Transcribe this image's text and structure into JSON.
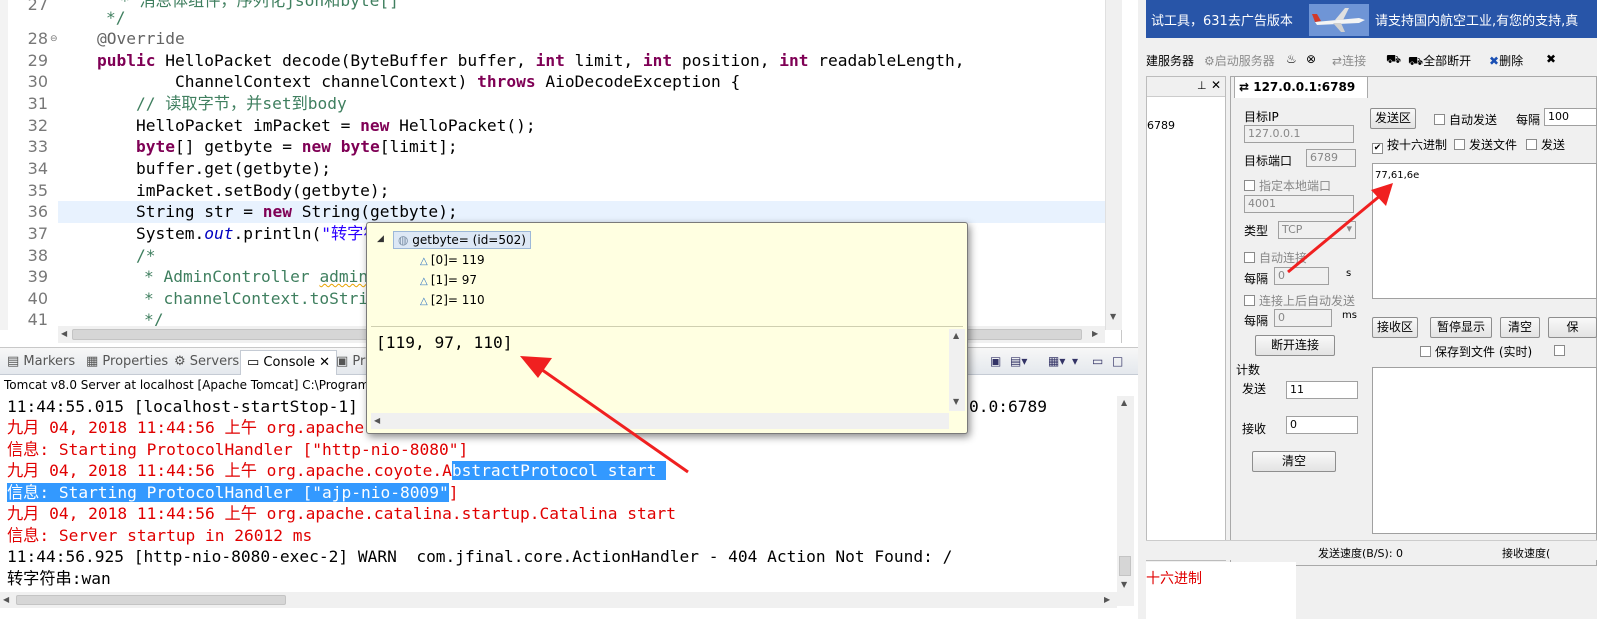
{
  "editor": {
    "line_numbers": [
      "27",
      "28",
      "29",
      "30",
      "31",
      "32",
      "33",
      "34",
      "35",
      "36",
      "37",
      "38",
      "39",
      "40",
      "41"
    ],
    "lines": {
      "l27_comment": "* 消息体组件，序列化json和byte[]",
      "l27b": "*/",
      "l28": "@Override",
      "l29_a": "public",
      "l29_b": " HelloPacket decode(ByteBuffer ",
      "l29_c": "buffer",
      "l29_d": ", ",
      "l29_e": "int",
      "l29_f": " ",
      "l29_g": "limit",
      "l29_h": ", ",
      "l29_i": "int",
      "l29_j": " ",
      "l29_k": "position",
      "l29_l": ", ",
      "l29_m": "int",
      "l29_n": " ",
      "l29_o": "readableLength",
      "l29_p": ",",
      "l30_a": "ChannelContext ",
      "l30_b": "channelContext",
      "l30_c": ") ",
      "l30_d": "throws",
      "l30_e": " AioDecodeException {",
      "l31": "// 读取字节，并set到body",
      "l32_a": "HelloPacket ",
      "l32_b": "imPacket",
      "l32_c": " = ",
      "l32_d": "new",
      "l32_e": " HelloPacket();",
      "l33_a": "byte",
      "l33_b": "[] ",
      "l33_c": "getbyte",
      "l33_d": " = ",
      "l33_e": "new",
      "l33_f": " ",
      "l33_g": "byte",
      "l33_h": "[",
      "l33_i": "limit",
      "l33_j": "];",
      "l34_a": "buffer",
      "l34_b": ".get(",
      "l34_c": "getbyte",
      "l34_d": ");",
      "l35_a": "imPacket",
      "l35_b": ".setBody(",
      "l35_c": "getbyte",
      "l35_d": ");",
      "l36_a": "String ",
      "l36_b": "str",
      "l36_c": " = ",
      "l36_d": "new",
      "l36_e": " String(",
      "l36_f": "getbyte",
      "l36_g": ");",
      "l37_a": "System.",
      "l37_b": "out",
      "l37_c": ".println(",
      "l37_d": "\"转字符",
      "l38": "/*",
      "l39_a": "* AdminController ",
      "l39_b": "admin",
      "l40": "* channelContext.toStri",
      "l41": "*/"
    }
  },
  "console": {
    "tabs": [
      "Markers",
      "Properties",
      "Servers",
      "Console",
      "Pr"
    ],
    "active_tab": "Console",
    "server_line": "Tomcat v8.0 Server at localhost [Apache Tomcat] C:\\Program Fi",
    "lines": {
      "c1a": "11:44:55.015 [localhost-startStop-1]",
      "c1b": "0.0:6789",
      "c2": "九月 04, 2018 11:44:56 上午 org.apache.c",
      "c3": "信息: Starting ProtocolHandler [\"http-nio-8080\"]",
      "c4a": "九月 04, 2018 11:44:56 上午 org.apache.coyote.A",
      "c4b": "bstractProtocol start ",
      "c5a": "信息: Starting ProtocolHandler [\"ajp-nio-8009\"",
      "c5b": "]",
      "c6": "九月 04, 2018 11:44:56 上午 org.apache.catalina.startup.Catalina start",
      "c7": "信息: Server startup in 26012 ms",
      "c8": "11:44:56.925 [http-nio-8080-exec-2] WARN  com.jfinal.core.ActionHandler - 404 Action Not Found: /",
      "c9": "转字符串:wan"
    }
  },
  "popup": {
    "root": "getbyte= (id=502)",
    "items": [
      "[0]= 119",
      "[1]= 97",
      "[2]= 110"
    ],
    "value": "[119, 97, 110]"
  },
  "tool": {
    "banner_left": "试工具，631去广告版本",
    "banner_right": "请支持国内航空工业,有您的支持,真",
    "toolbar": {
      "create_server": "建服务器",
      "start_server": "启动服务器",
      "connect": "连接",
      "disconnect_all": "全部断开",
      "delete": "删除"
    },
    "list_value": "6789",
    "conn_tab": "127.0.0.1:6789",
    "target_ip_label": "目标IP",
    "target_ip": "127.0.0.1",
    "target_port_label": "目标端口",
    "target_port": "6789",
    "local_port_label": "指定本地端口",
    "local_port": "4001",
    "type_label": "类型",
    "type_value": "TCP",
    "auto_connect": "自动连接",
    "every_label": "每隔",
    "every1": "0",
    "unit_s": "s",
    "auto_send_after": "连接上后自动发送",
    "every2": "0",
    "unit_ms": "ms",
    "disconnect_btn": "断开连接",
    "count_label": "计数",
    "send_label": "发送",
    "send_count": "11",
    "recv_label": "接收",
    "recv_count": "0",
    "clear_btn": "清空",
    "send_area_btn": "发送区",
    "auto_send": "自动发送",
    "every3": "每隔",
    "every3_val": "100",
    "hex_send": "按十六进制",
    "send_file": "发送文件",
    "send_more": "发送",
    "send_content": "77,61,6e",
    "recv_area_btn": "接收区",
    "pause_btn": "暂停显示",
    "clear2_btn": "清空",
    "save_btn": "保",
    "save_to_file": "保存到文件 (实时)",
    "send_speed": "发送速度(B/S): 0",
    "recv_speed": "接收速度(",
    "hex_label": "十六进制"
  }
}
